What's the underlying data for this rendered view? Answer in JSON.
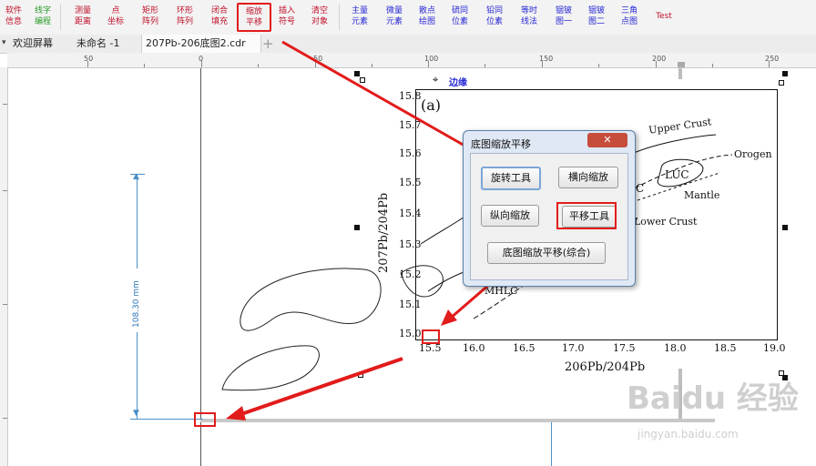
{
  "toolbar": {
    "items": [
      {
        "label": "软件\n信息",
        "color": "red"
      },
      {
        "label": "线字\n编程",
        "color": "green"
      },
      {
        "label": "测量\n距离",
        "color": "red"
      },
      {
        "label": "点\n坐标",
        "color": "red"
      },
      {
        "label": "矩形\n阵列",
        "color": "red"
      },
      {
        "label": "环形\n阵列",
        "color": "red"
      },
      {
        "label": "闭合\n填充",
        "color": "red"
      },
      {
        "label": "缩放\n平移",
        "color": "red"
      },
      {
        "label": "插入\n符号",
        "color": "red"
      },
      {
        "label": "清空\n对象",
        "color": "red"
      },
      {
        "label": "主量\n元素",
        "color": "blue"
      },
      {
        "label": "微量\n元素",
        "color": "blue"
      },
      {
        "label": "散点\n绘图",
        "color": "blue"
      },
      {
        "label": "硫同\n位素",
        "color": "blue"
      },
      {
        "label": "铅同\n位素",
        "color": "blue"
      },
      {
        "label": "等时\n线法",
        "color": "blue"
      },
      {
        "label": "铟铍\n图一",
        "color": "blue"
      },
      {
        "label": "铟铍\n图二",
        "color": "blue"
      },
      {
        "label": "三角\n点图",
        "color": "blue"
      },
      {
        "label": "Test",
        "color": "red"
      }
    ]
  },
  "tabs": [
    {
      "label": "欢迎屏幕"
    },
    {
      "label": "未命名 -1"
    },
    {
      "label": "207Pb-206底图2.cdr"
    },
    {
      "label": "+"
    }
  ],
  "ruler": {
    "h_labels": [
      "50",
      "0",
      "50",
      "100",
      "150",
      "200",
      "250"
    ]
  },
  "canvas": {
    "edge_label": "边缘",
    "dimension": "108.30 mm"
  },
  "plot": {
    "panel": "(a)",
    "y_ticks": [
      "15.8",
      "15.7",
      "15.6",
      "15.5",
      "15.4",
      "15.3",
      "15.2",
      "15.1",
      "15.0"
    ],
    "x_ticks": [
      "15.5",
      "16.0",
      "16.5",
      "17.0",
      "17.5",
      "18.0",
      "18.5",
      "19.0"
    ],
    "y_axis_label": "207Pb/204Pb",
    "x_axis_label": "206Pb/204Pb",
    "curves": [
      "Upper Crust",
      "Orogen",
      "LUC",
      "Mantle",
      "Lower Crust",
      "MHLC",
      "C"
    ]
  },
  "dialog": {
    "title": "底图缩放平移",
    "close": "✕",
    "buttons": {
      "rotate": "旋转工具",
      "h_scale": "横向缩放",
      "v_scale": "纵向缩放",
      "pan": "平移工具",
      "combined": "底图缩放平移(综合)"
    }
  },
  "watermark": {
    "brand": "Baidu 经验",
    "url": "jingyan.baidu.com"
  },
  "colors": {
    "accent_red": "#e21b1b",
    "guide_blue": "#4a90c8",
    "toolbar_red": "#c0112a",
    "toolbar_blue": "#2a2ad6",
    "toolbar_green": "#2a9d2a"
  }
}
